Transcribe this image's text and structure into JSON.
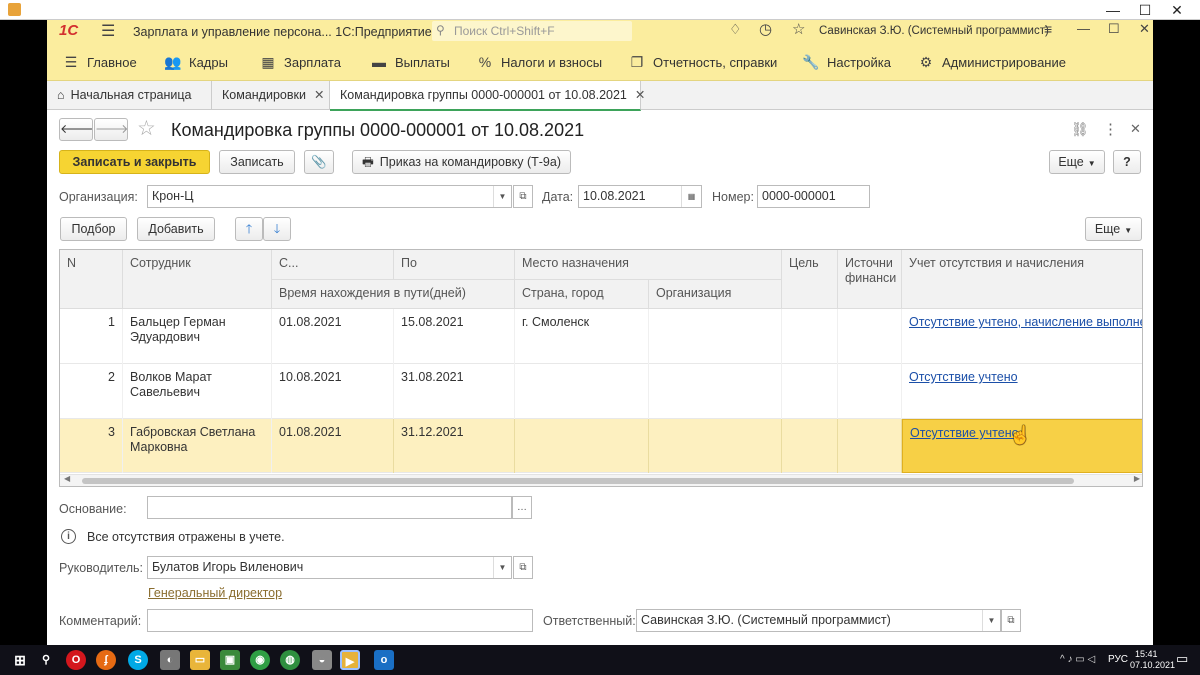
{
  "app": {
    "logo": "1С",
    "title": "Зарплата и управление персона... 1С:Предприятие",
    "search_placeholder": "Поиск Ctrl+Shift+F",
    "user": "Савинская З.Ю. (Системный программист)"
  },
  "sections": [
    "Главное",
    "Кадры",
    "Зарплата",
    "Выплаты",
    "Налоги и взносы",
    "Отчетность, справки",
    "Настройка",
    "Администрирование"
  ],
  "tabs": {
    "home": "Начальная страница",
    "t1": "Командировки",
    "t2": "Командировка группы 0000-000001 от 10.08.2021"
  },
  "doc": {
    "title": "Командировка группы 0000-000001 от 10.08.2021",
    "save_close": "Записать и закрыть",
    "save": "Записать",
    "print_order": "Приказ на командировку (Т-9а)",
    "more": "Еще",
    "help": "?",
    "org_label": "Организация:",
    "org_value": "Крон-Ц",
    "date_label": "Дата:",
    "date_value": "10.08.2021",
    "number_label": "Номер:",
    "number_value": "0000-000001",
    "pick": "Подбор",
    "add": "Добавить",
    "more2": "Еще"
  },
  "table": {
    "headers": {
      "n": "N",
      "employee": "Сотрудник",
      "from": "С...",
      "to": "По",
      "travel": "Время нахождения в пути(дней)",
      "destination": "Место назначения",
      "country_city": "Страна, город",
      "organization": "Организация",
      "purpose": "Цель",
      "funding_1": "Источни",
      "funding_2": "финанси",
      "absence": "Учет отсутствия и начисления"
    },
    "rows": [
      {
        "n": "1",
        "name1": "Бальцер Герман",
        "name2": "Эдуардович",
        "from": "01.08.2021",
        "to": "15.08.2021",
        "city": "г. Смоленск",
        "status": "Отсутствие учтено, начисление выполнено"
      },
      {
        "n": "2",
        "name1": "Волков Марат",
        "name2": "Савельевич",
        "from": "10.08.2021",
        "to": "31.08.2021",
        "city": "",
        "status": "Отсутствие учтено"
      },
      {
        "n": "3",
        "name1": "Габровская Светлана",
        "name2": "Марковна",
        "from": "01.08.2021",
        "to": "31.12.2021",
        "city": "",
        "status": "Отсутствие учтено"
      }
    ]
  },
  "footer": {
    "basis_label": "Основание:",
    "info": "Все отсутствия отражены в учете.",
    "manager_label": "Руководитель:",
    "manager_value": "Булатов Игорь Виленович",
    "manager_position": "Генеральный директор",
    "comment_label": "Комментарий:",
    "responsible_label": "Ответственный:",
    "responsible_value": "Савинская З.Ю. (Системный программист)"
  },
  "taskbar": {
    "lang": "РУС",
    "time": "15:41",
    "date": "07.10.2021"
  },
  "colors": {
    "accent_yellow": "#f6d432",
    "menu_bg": "#fbed9e",
    "selected_row": "#fdf0c0",
    "link": "#1b4fa8"
  }
}
